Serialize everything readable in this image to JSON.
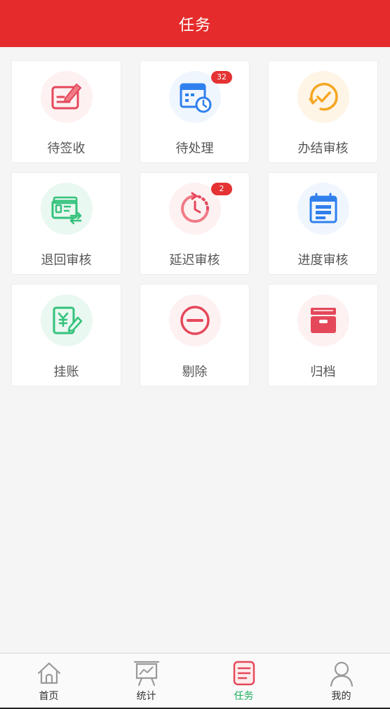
{
  "header": {
    "title": "任务"
  },
  "tasks": [
    {
      "label": "待签收",
      "icon": "sign-form-icon",
      "badge": ""
    },
    {
      "label": "待处理",
      "icon": "calendar-clock-icon",
      "badge": "32"
    },
    {
      "label": "办结审核",
      "icon": "check-circle-icon",
      "badge": ""
    },
    {
      "label": "退回审核",
      "icon": "card-return-icon",
      "badge": ""
    },
    {
      "label": "延迟审核",
      "icon": "delay-clock-icon",
      "badge": "2"
    },
    {
      "label": "进度审核",
      "icon": "progress-list-icon",
      "badge": ""
    },
    {
      "label": "挂账",
      "icon": "yen-doc-edit-icon",
      "badge": ""
    },
    {
      "label": "剔除",
      "icon": "minus-circle-icon",
      "badge": ""
    },
    {
      "label": "归档",
      "icon": "archive-box-icon",
      "badge": ""
    }
  ],
  "tabbar": {
    "active": "任务",
    "items": [
      {
        "label": "首页",
        "icon": "home-icon"
      },
      {
        "label": "统计",
        "icon": "chart-board-icon"
      },
      {
        "label": "任务",
        "icon": "task-list-icon"
      },
      {
        "label": "我的",
        "icon": "user-icon"
      }
    ]
  },
  "colors": {
    "header": "#e52b2b",
    "badge": "#e53333",
    "active_tab": "#1aad5b",
    "red_icon": "#e5485a",
    "blue_icon": "#2f80ed",
    "orange_icon": "#f5a623",
    "green_icon": "#34c27c"
  }
}
